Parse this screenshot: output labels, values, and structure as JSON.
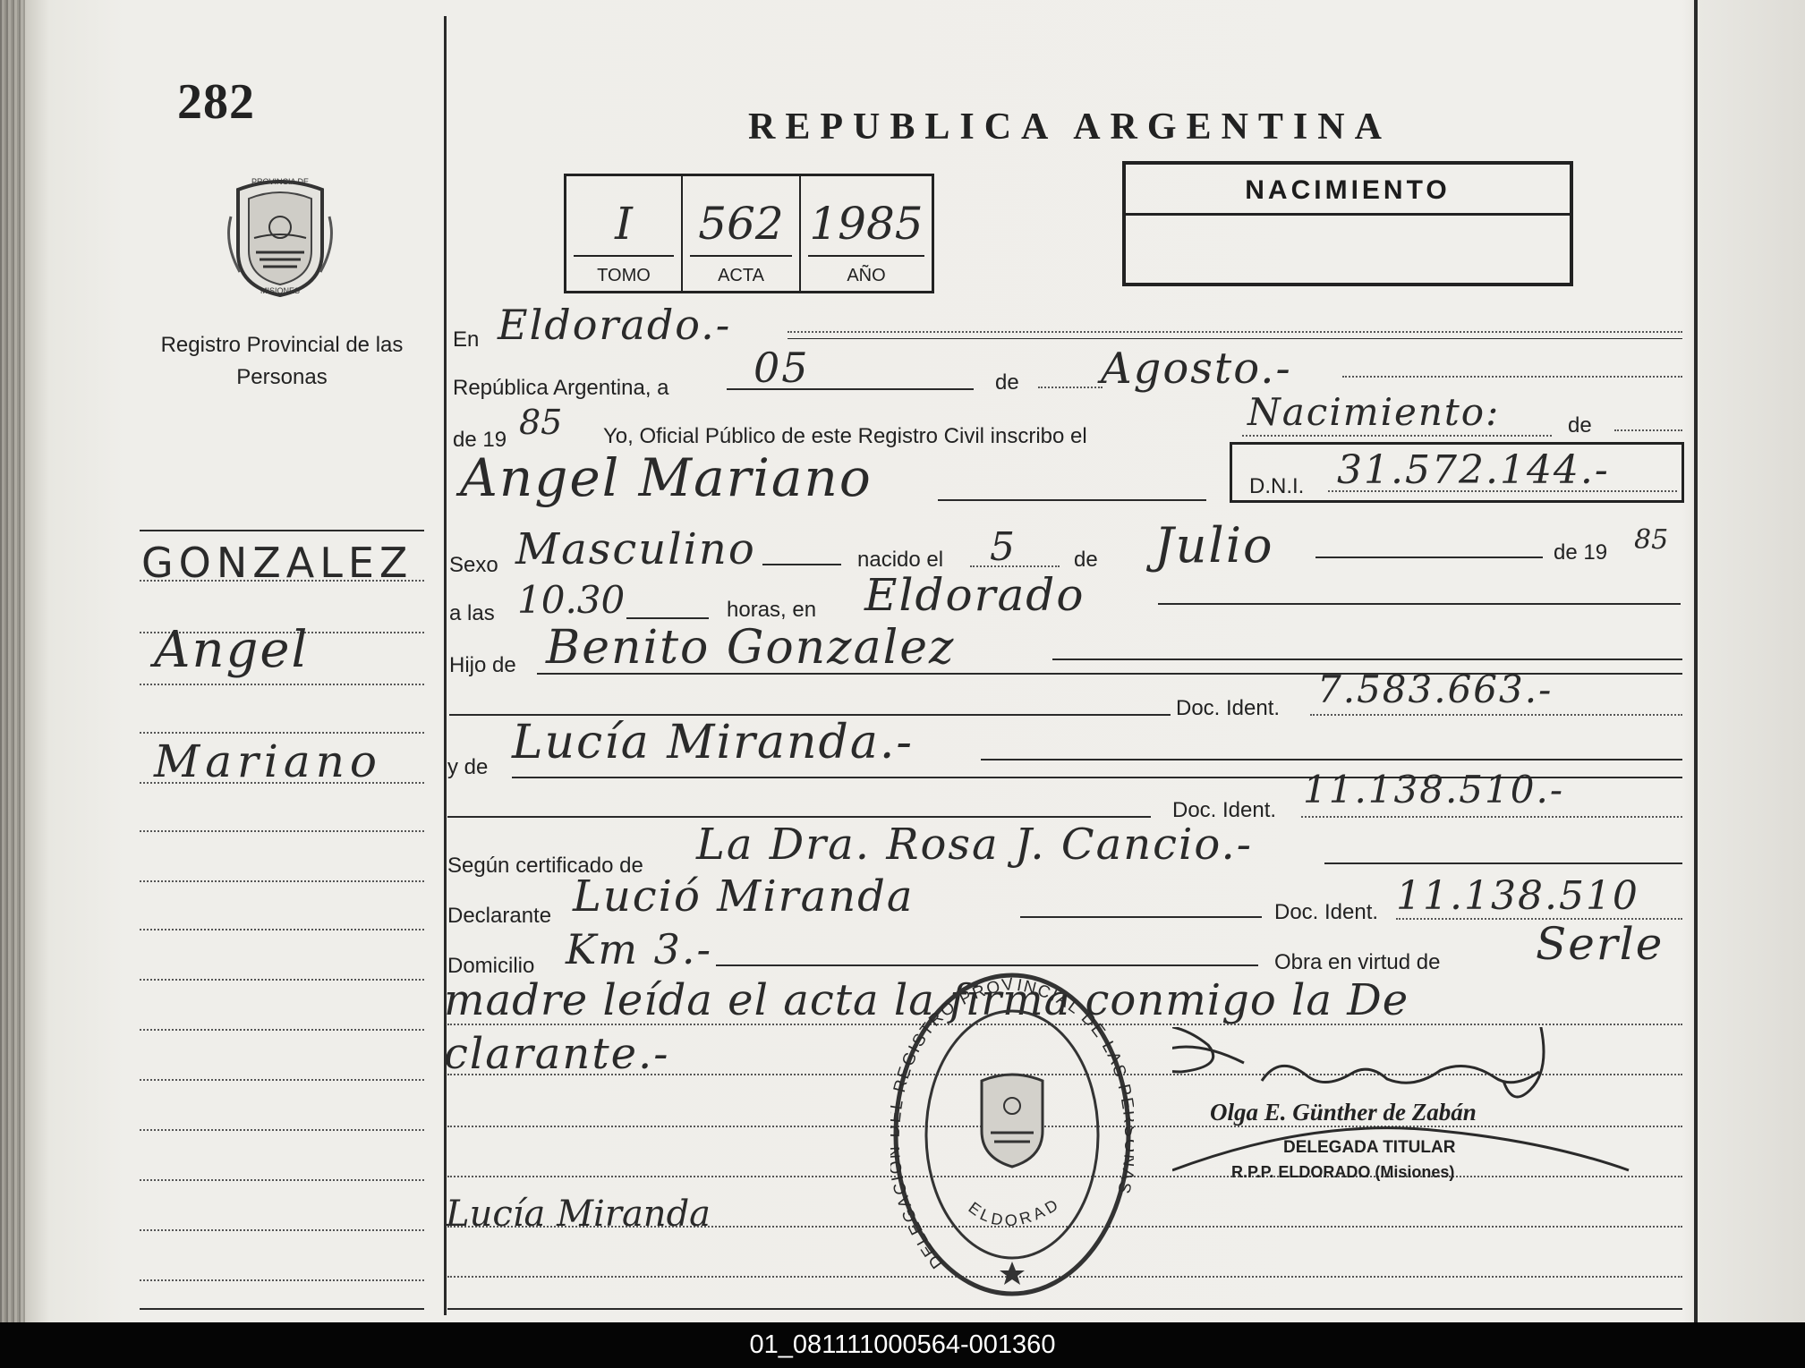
{
  "document": {
    "page_number": "282",
    "title": "REPUBLICA ARGENTINA",
    "left_seal": {
      "icon": "province-seal-icon",
      "text_top": "PROVINCIA DE",
      "text_bottom": "MISIONES"
    },
    "registry_name": "Registro Provincial de las Personas",
    "record_box": {
      "tomo": {
        "value": "I",
        "label": "TOMO"
      },
      "acta": {
        "value": "562",
        "label": "ACTA"
      },
      "anio": {
        "value": "1985",
        "label": "AÑO"
      }
    },
    "record_type": "NACIMIENTO",
    "margin_names": [
      "GONZALEZ",
      "Angel",
      "Mariano"
    ],
    "fields": {
      "en": {
        "label": "En",
        "value": "Eldorado.-"
      },
      "republica": {
        "label": "República Argentina, a",
        "day": "05",
        "de_label": "de",
        "month": "Agosto.-"
      },
      "anio_line": {
        "label_prefix": "de 19",
        "year": "85",
        "label_text": "Yo, Oficial Público de este Registro Civil inscribo el",
        "value": "Nacimiento:",
        "label_suffix": "de"
      },
      "name_line": {
        "value": "Angel Mariano",
        "dni_label": "D.N.I.",
        "dni_value": "31.572.144.-"
      },
      "sexo": {
        "label": "Sexo",
        "value": "Masculino",
        "nacido_label": "nacido el",
        "day": "5",
        "de_label": "de",
        "month": "Julio",
        "year_label": "de 19",
        "year": "85"
      },
      "hora": {
        "label": "a las",
        "value": "10.30",
        "horas_label": "horas, en",
        "place": "Eldorado"
      },
      "padre": {
        "label": "Hijo de",
        "value": "Benito Gonzalez",
        "doc_label": "Doc. Ident.",
        "doc_value": "7.583.663.-"
      },
      "madre": {
        "label": "y de",
        "value": "Lucía Miranda.-",
        "doc_label": "Doc. Ident.",
        "doc_value": "11.138.510.-"
      },
      "certificado": {
        "label": "Según certificado de",
        "value": "La Dra. Rosa J. Cancio.-"
      },
      "declarante": {
        "label": "Declarante",
        "value": "Lució Miranda",
        "doc_label": "Doc. Ident.",
        "doc_value": "11.138.510"
      },
      "domicilio": {
        "label": "Domicilio",
        "value": "Km 3.-",
        "obra_label": "Obra en virtud de",
        "obra_value": "Serle"
      },
      "obra_cont_1": "madre leída el acta la firma conmigo la De",
      "obra_cont_2": "clarante.-"
    },
    "stamp": {
      "icon": "official-round-stamp-icon",
      "text_outer": "DELEGACION DEL REGISTRO PROVINCIAL DE LAS PERSONAS",
      "text_inner": "ELDORADO"
    },
    "signature_block": {
      "name": "Olga E. Günther de Zabán",
      "role": "DELEGADA TITULAR",
      "office": "R.P.P. ELDORADO (Misiones)"
    },
    "declarant_signature": "Lucía Miranda",
    "footer_id": "01_081111000564-001360"
  }
}
